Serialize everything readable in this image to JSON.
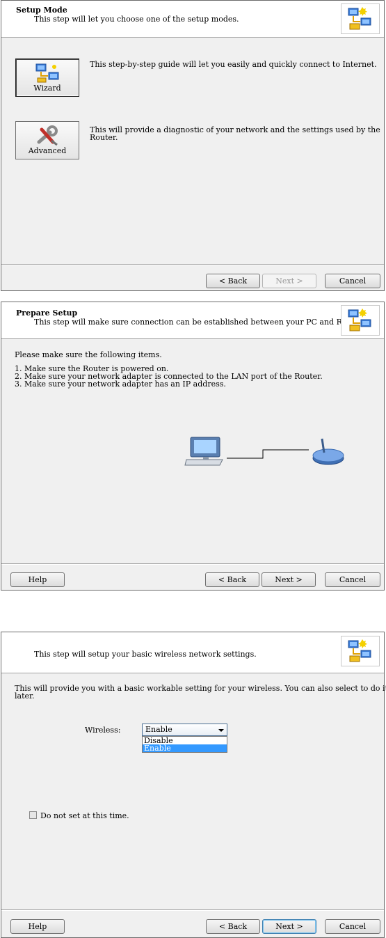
{
  "setup_mode": {
    "title": "Setup Mode",
    "subtitle": "This step will let you choose one of the setup modes.",
    "wizard_label": "Wizard",
    "wizard_desc": "This step-by-step guide will let you easily and quickly connect to Internet.",
    "advanced_label": "Advanced",
    "advanced_desc_line1": "This will provide a diagnostic of your network and the settings used by the",
    "advanced_desc_line2": "Router.",
    "back": "< Back",
    "next": "Next >",
    "cancel": "Cancel"
  },
  "prepare_setup": {
    "title": "Prepare Setup",
    "subtitle": "This step will make sure connection can be established between your PC and Router",
    "intro": "Please make sure the following items.",
    "items": [
      "1. Make sure the Router is powered on.",
      "2. Make sure your network adapter is connected to the LAN port of the Router.",
      "3. Make sure your network adapter has an IP address."
    ],
    "help": "Help",
    "back": "< Back",
    "next": "Next >",
    "cancel": "Cancel"
  },
  "wireless": {
    "subtitle": "This step will setup your basic wireless network settings.",
    "desc_line1": "This will provide you with a basic workable setting for your wireless. You can also select to do it",
    "desc_line2": "later.",
    "wireless_label": "Wireless:",
    "selected_value": "Enable",
    "options": [
      "Disable",
      "Enable"
    ],
    "skip_label": "Do not set at this time.",
    "help": "Help",
    "back": "< Back",
    "next": "Next >",
    "cancel": "Cancel"
  }
}
